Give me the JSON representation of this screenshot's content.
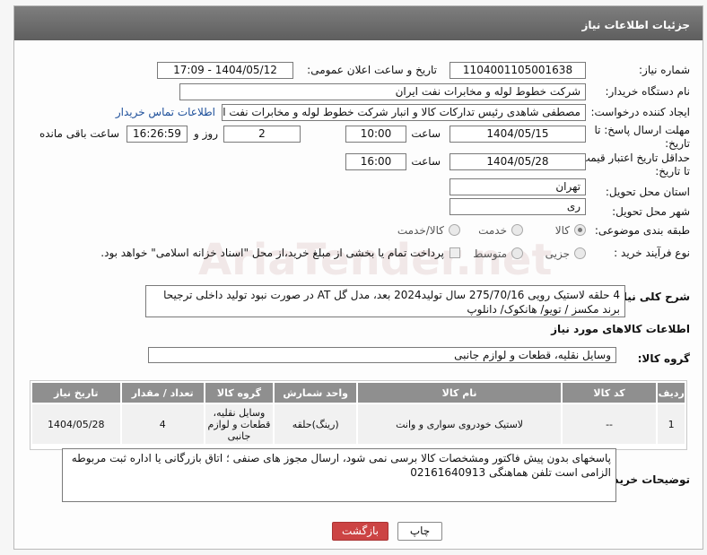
{
  "header": {
    "title": "جزئیات اطلاعات نیاز"
  },
  "need_number": {
    "label": "شماره نیاز:",
    "value": "1104001105001638"
  },
  "announce": {
    "label": "تاریخ و ساعت اعلان عمومی:",
    "value": "1404/05/12 - 17:09"
  },
  "buyer_org": {
    "label": "نام دستگاه خریدار:",
    "value": "شرکت خطوط لوله و مخابرات نفت ایران"
  },
  "creator": {
    "label": "ایجاد کننده درخواست:",
    "value": "مصطفی  شاهدی رئیس تدارکات کالا و انبار شرکت خطوط لوله و مخابرات نفت ایر",
    "contact_link": "اطلاعات تماس خریدار"
  },
  "reply_deadline": {
    "label_line1": "مهلت ارسال پاسخ: تا",
    "label_line2": "تاریخ:",
    "date": "1404/05/15",
    "time_label": "ساعت",
    "time": "10:00",
    "days": "2",
    "days_label": "روز و",
    "remaining_time": "16:26:59",
    "remaining_label": "ساعت باقی مانده"
  },
  "price_validity": {
    "label_line1": "حداقل تاریخ اعتبار قیمت:",
    "label_line2": "تا تاریخ:",
    "date": "1404/05/28",
    "time_label": "ساعت",
    "time": "16:00"
  },
  "province": {
    "label": "استان محل تحویل:",
    "value": "تهران"
  },
  "city": {
    "label": "شهر محل تحویل:",
    "value": "ری"
  },
  "category": {
    "label": "طبقه بندی موضوعی:",
    "options": [
      "کالا",
      "خدمت",
      "کالا/خدمت"
    ]
  },
  "process": {
    "label": "نوع فرآیند خرید :",
    "options": [
      "جزیی",
      "متوسط"
    ],
    "payment_note": "پرداخت تمام یا بخشی از مبلغ خرید،از محل \"اسناد خزانه اسلامی\" خواهد بود."
  },
  "description": {
    "label": "شرح کلی نیاز:",
    "value": "4 حلقه لاستیک رویی 275/70/16   سال تولید2024 بعد، مدل گل AT در صورت نبود تولید داخلی  ترجیحا برند مکسز / تویو/ هانکوک/ دانلوپ"
  },
  "goods_info": {
    "title": "اطلاعات کالاهای مورد نیاز"
  },
  "goods_group": {
    "label": "گروه کالا:",
    "value": "وسایل نقلیه، قطعات و لوازم جانبی"
  },
  "table": {
    "headers": [
      "ردیف",
      "کد کالا",
      "نام کالا",
      "واحد شمارش",
      "گروه کالا",
      "تعداد / مقدار",
      "تاریخ نیاز"
    ],
    "rows": [
      [
        "1",
        "--",
        "لاستیک خودروی سواری و وانت",
        "(رینگ)حلقه",
        "وسایل نقلیه، قطعات و لوازم جانبی",
        "4",
        "1404/05/28"
      ]
    ]
  },
  "buyer_notes": {
    "label": "توضیحات خریدار:",
    "value": "پاسخهای بدون پیش فاکتور ومشخصات کالا برسی نمی شود، ارسال مجوز های صنفی ؛ اتاق بازرگانی یا اداره ثبت  مربوطه الزامی است تلفن هماهنگی  02161640913"
  },
  "buttons": {
    "print": "چاپ",
    "back": "بازگشت"
  }
}
